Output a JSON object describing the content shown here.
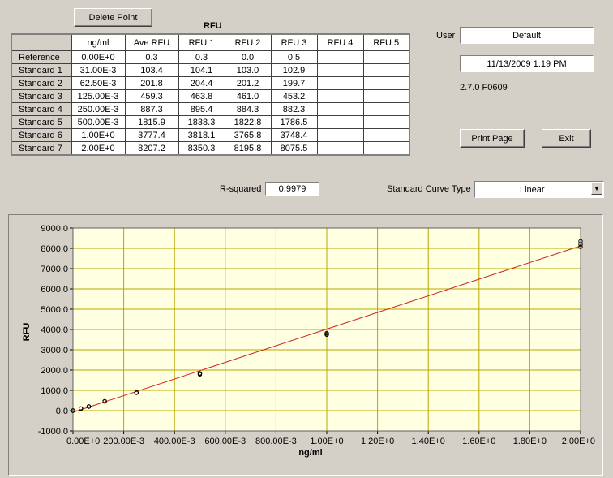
{
  "toolbar": {
    "delete_point_label": "Delete Point"
  },
  "table": {
    "title": "RFU",
    "columns": [
      "",
      "ng/ml",
      "Ave RFU",
      "RFU 1",
      "RFU 2",
      "RFU 3",
      "RFU 4",
      "RFU 5"
    ],
    "rows": [
      [
        "Reference",
        "0.00E+0",
        "0.3",
        "0.3",
        "0.0",
        "0.5",
        "",
        ""
      ],
      [
        "Standard 1",
        "31.00E-3",
        "103.4",
        "104.1",
        "103.0",
        "102.9",
        "",
        ""
      ],
      [
        "Standard 2",
        "62.50E-3",
        "201.8",
        "204.4",
        "201.2",
        "199.7",
        "",
        ""
      ],
      [
        "Standard 3",
        "125.00E-3",
        "459.3",
        "463.8",
        "461.0",
        "453.2",
        "",
        ""
      ],
      [
        "Standard 4",
        "250.00E-3",
        "887.3",
        "895.4",
        "884.3",
        "882.3",
        "",
        ""
      ],
      [
        "Standard 5",
        "500.00E-3",
        "1815.9",
        "1838.3",
        "1822.8",
        "1786.5",
        "",
        ""
      ],
      [
        "Standard 6",
        "1.00E+0",
        "3777.4",
        "3818.1",
        "3765.8",
        "3748.4",
        "",
        ""
      ],
      [
        "Standard 7",
        "2.00E+0",
        "8207.2",
        "8350.3",
        "8195.8",
        "8075.5",
        "",
        ""
      ]
    ]
  },
  "user": {
    "label": "User",
    "value": "Default"
  },
  "datetime": "11/13/2009  1:19 PM",
  "version": "2.7.0 F0609",
  "actions": {
    "print_label": "Print Page",
    "exit_label": "Exit"
  },
  "rsquared": {
    "label": "R-squared",
    "value": "0.9979"
  },
  "curve_type": {
    "label": "Standard Curve Type",
    "value": "Linear"
  },
  "colors": {
    "plot_bg": "#ffffe1",
    "grid": "#b8a800",
    "fit_line": "#d02020",
    "points": "#000000"
  },
  "chart_data": {
    "type": "scatter",
    "xlabel": "ng/ml",
    "ylabel": "RFU",
    "xlim": [
      0,
      2.0
    ],
    "ylim": [
      -1000,
      9000
    ],
    "x_ticks": [
      0,
      0.2,
      0.4,
      0.6,
      0.8,
      1.0,
      1.2,
      1.4,
      1.6,
      1.8,
      2.0
    ],
    "x_tick_labels": [
      "0.00E+0",
      "200.00E-3",
      "400.00E-3",
      "600.00E-3",
      "800.00E-3",
      "1.00E+0",
      "1.20E+0",
      "1.40E+0",
      "1.60E+0",
      "1.80E+0",
      "2.00E+0"
    ],
    "y_ticks": [
      -1000,
      0,
      1000,
      2000,
      3000,
      4000,
      5000,
      6000,
      7000,
      8000,
      9000
    ],
    "y_tick_labels": [
      "-1000.0",
      "0.0",
      "1000.0",
      "2000.0",
      "3000.0",
      "4000.0",
      "5000.0",
      "6000.0",
      "7000.0",
      "8000.0",
      "9000.0"
    ],
    "grid": true,
    "points": [
      [
        0,
        0.3
      ],
      [
        0,
        0.0
      ],
      [
        0,
        0.5
      ],
      [
        0.031,
        104.1
      ],
      [
        0.031,
        103.0
      ],
      [
        0.031,
        102.9
      ],
      [
        0.0625,
        204.4
      ],
      [
        0.0625,
        201.2
      ],
      [
        0.0625,
        199.7
      ],
      [
        0.125,
        463.8
      ],
      [
        0.125,
        461.0
      ],
      [
        0.125,
        453.2
      ],
      [
        0.25,
        895.4
      ],
      [
        0.25,
        884.3
      ],
      [
        0.25,
        882.3
      ],
      [
        0.5,
        1838.3
      ],
      [
        0.5,
        1822.8
      ],
      [
        0.5,
        1786.5
      ],
      [
        1.0,
        3818.1
      ],
      [
        1.0,
        3765.8
      ],
      [
        1.0,
        3748.4
      ],
      [
        2.0,
        8350.3
      ],
      [
        2.0,
        8195.8
      ],
      [
        2.0,
        8075.5
      ]
    ],
    "fit_line": {
      "x": [
        0,
        2.0
      ],
      "y": [
        -80,
        8120
      ]
    }
  }
}
